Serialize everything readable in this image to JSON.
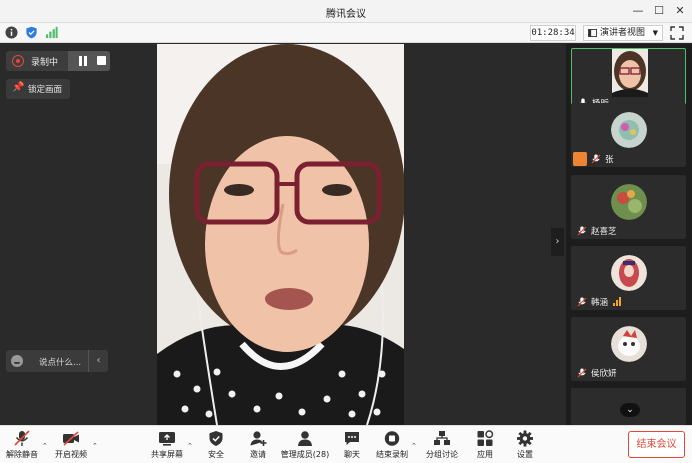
{
  "window": {
    "title": "腾讯会议",
    "controls": [
      "minimize-icon",
      "maximize-icon",
      "close-icon"
    ]
  },
  "statusbar": {
    "timer": "01:28:34",
    "view_mode": "演讲者视图",
    "icons": [
      "info-icon",
      "shield-icon",
      "signal-icon",
      "fullscreen-icon"
    ]
  },
  "recording": {
    "label": "录制中"
  },
  "pin_view": {
    "label": "锁定画面"
  },
  "chat": {
    "placeholder": "说点什么..."
  },
  "participants": [
    {
      "name": "杨昕",
      "avatar_color": "#d8a18a",
      "active": true
    },
    {
      "name": "张",
      "avatar_color": "#b9c9c0",
      "host_badge": true
    },
    {
      "name": "赵喜芝",
      "avatar_color": "#6f8f4e"
    },
    {
      "name": "韩涵",
      "avatar_color": "#c8494d",
      "speaking": true
    },
    {
      "name": "侯欣妍",
      "avatar_color": "#d9d2c6"
    }
  ],
  "toolbar": {
    "mute": "解除静音",
    "video": "开启视频",
    "share": "共享屏幕",
    "security": "安全",
    "invite": "邀请",
    "members": "管理成员(28)",
    "chat": "聊天",
    "end_recording": "结束录制",
    "breakout": "分组讨论",
    "apps": "应用",
    "settings": "设置",
    "end_meeting": "结束会议"
  },
  "colors": {
    "accent_red": "#e5483b",
    "active_border": "#4fbf6a",
    "signal_orange": "#f5a623",
    "host_orange": "#ef8533"
  }
}
